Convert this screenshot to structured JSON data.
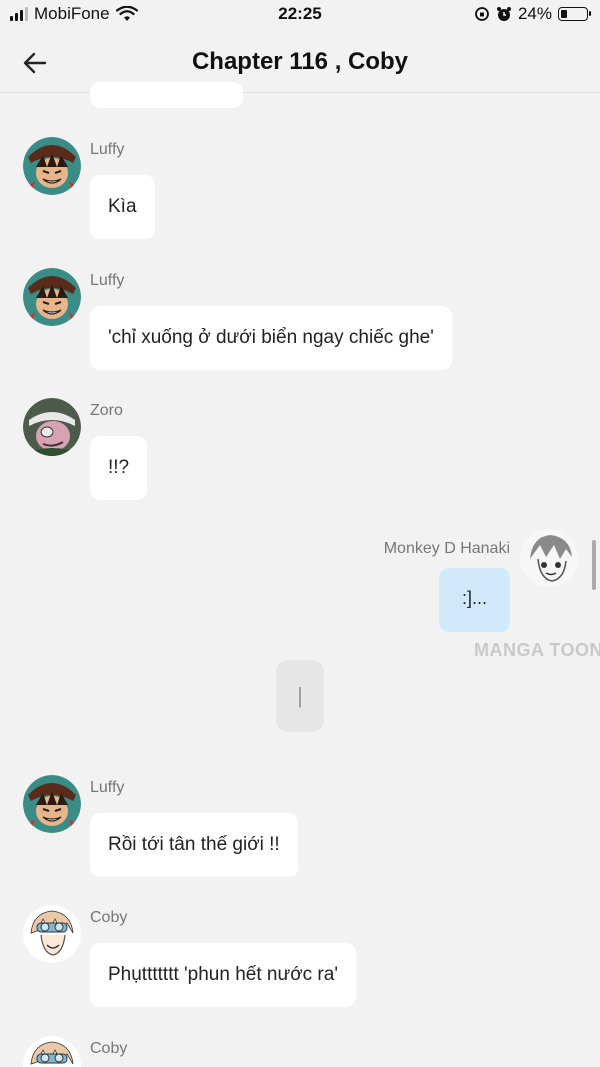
{
  "status_bar": {
    "carrier": "MobiFone",
    "time": "22:25",
    "battery_percent": "24%",
    "battery_level": 0.24
  },
  "header": {
    "title": "Chapter 116 , Coby"
  },
  "messages": [
    {
      "sender": "Luffy",
      "text": "Kìa",
      "side": "left"
    },
    {
      "sender": "Luffy",
      "text": "'chỉ xuống ở dưới biển ngay chiếc ghe'",
      "side": "left"
    },
    {
      "sender": "Zoro",
      "text": "!!?",
      "side": "left"
    },
    {
      "sender": "Monkey D Hanaki",
      "text": ":]...",
      "side": "right"
    },
    {
      "sender": "",
      "text": "|",
      "side": "center"
    },
    {
      "sender": "Luffy",
      "text": "Rồi tới tân thế giới !!",
      "side": "left"
    },
    {
      "sender": "Coby",
      "text": "Phụttttttt 'phun hết nước ra'",
      "side": "left"
    },
    {
      "sender": "Coby",
      "text": "",
      "side": "left"
    }
  ],
  "watermark": "MANGA TOON",
  "colors": {
    "background": "#f2f2f2",
    "bubble_left": "#ffffff",
    "bubble_right": "#cfe9fb"
  }
}
